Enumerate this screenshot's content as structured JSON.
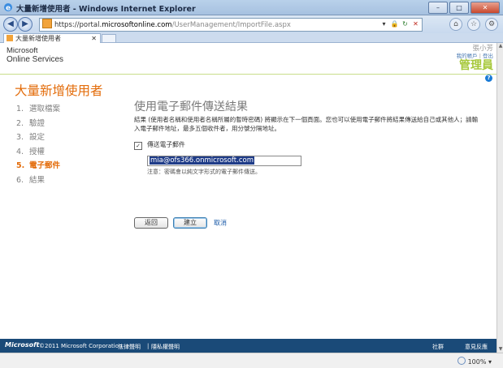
{
  "window": {
    "title": "大量新增使用者 - Windows Internet Explorer"
  },
  "browser": {
    "url_prefix": "https://portal.",
    "url_host": "microsoftonline.com",
    "url_path": "/UserManagement/ImportFile.aspx",
    "tab_title": "大量新增使用者",
    "zoom": "100%"
  },
  "header": {
    "brand_line1": "Microsoft",
    "brand_line2": "Online Services",
    "user_name": "張小芳",
    "link_profile": "我的帳戶",
    "link_sep": "|",
    "link_signout": "登出",
    "role": "管理員"
  },
  "page": {
    "title": "大量新增使用者",
    "steps": [
      {
        "num": "1.",
        "label": "選取檔案"
      },
      {
        "num": "2.",
        "label": "驗證"
      },
      {
        "num": "3.",
        "label": "設定"
      },
      {
        "num": "4.",
        "label": "授權"
      },
      {
        "num": "5.",
        "label": "電子郵件"
      },
      {
        "num": "6.",
        "label": "結果"
      }
    ],
    "active_step": 4,
    "section_title": "使用電子郵件傳送結果",
    "description": "結果 (使用者名稱和使用者名稱所屬的暫時密碼) 將顯示在下一個頁面。您也可以使用電子郵件將結果傳送給自己或其他人；請輸入電子郵件地址，最多五個收件者，用分號分隔地址。",
    "send_email_checkbox_label": "傳送電子郵件",
    "send_email_checked": true,
    "checkbox_mark": "✓",
    "email_value": "mia@ofs366.onmicrosoft.com",
    "note": "注意：密碼會以純文字形式的電子郵件傳送。",
    "back_button": "返回",
    "create_button": "建立",
    "cancel_link": "取消"
  },
  "footer": {
    "ms_logo": "Microsoft",
    "copyright": "©2011 Microsoft Corporation",
    "legal": "法律聲明",
    "sep": "|",
    "privacy": "隱私權聲明",
    "community": "社群",
    "feedback": "意見反應"
  },
  "colors": {
    "accent_orange": "#e36c0a",
    "role_green": "#a6c83a",
    "footer_blue": "#1a4a78",
    "link_blue": "#1a5aa8"
  }
}
